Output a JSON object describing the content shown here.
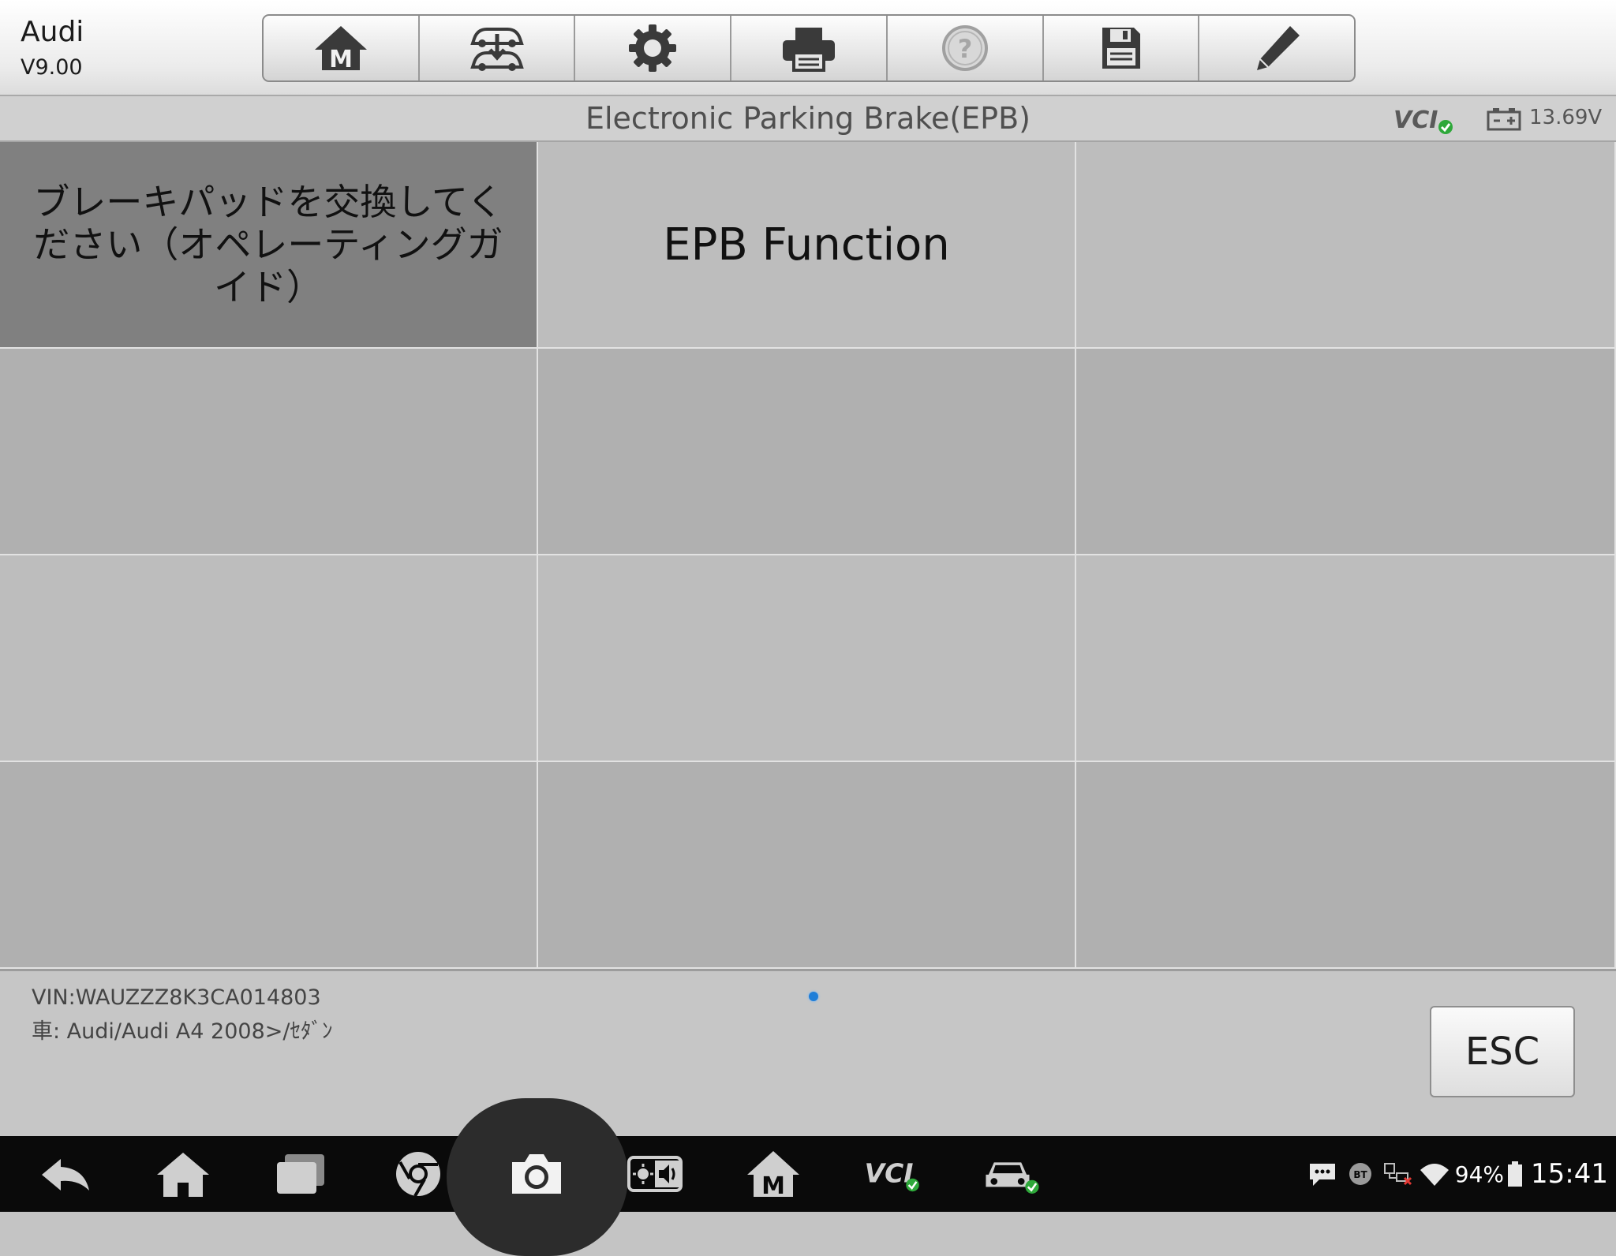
{
  "header": {
    "app_name": "Audi",
    "version": "V9.00",
    "toolbar": [
      {
        "name": "home",
        "icon": "home-m-icon"
      },
      {
        "name": "vehicle-swap",
        "icon": "vehicle-swap-icon"
      },
      {
        "name": "settings",
        "icon": "gear-icon"
      },
      {
        "name": "print",
        "icon": "printer-icon"
      },
      {
        "name": "help",
        "icon": "help-icon"
      },
      {
        "name": "save",
        "icon": "floppy-disk-icon"
      },
      {
        "name": "edit",
        "icon": "pencil-icon"
      }
    ]
  },
  "title_strip": {
    "title": "Electronic Parking Brake(EPB)",
    "vci_label": "VCI",
    "voltage": "13.69V"
  },
  "grid": {
    "cells": [
      {
        "label": "ブレーキパッドを交換してください（オペレーティングガイド）",
        "selected": true
      },
      {
        "label": "EPB Function"
      },
      {
        "label": ""
      },
      {
        "label": ""
      },
      {
        "label": ""
      },
      {
        "label": ""
      },
      {
        "label": ""
      },
      {
        "label": ""
      },
      {
        "label": ""
      },
      {
        "label": ""
      },
      {
        "label": ""
      },
      {
        "label": ""
      }
    ]
  },
  "footer": {
    "vin": "VIN:WAUZZZ8K3CA014803",
    "vehicle": "車: Audi/Audi A4 2008>/ｾﾀﾞﾝ",
    "esc_label": "ESC"
  },
  "system_bar": {
    "battery_percent": "94%",
    "time": "15:41",
    "bt_label": "BT"
  },
  "colors": {
    "selected_cell": "#808080",
    "cell_light": "#bdbdbd",
    "cell_dark": "#b0b0b0",
    "vci_check": "#2ea83a",
    "page_dot": "#1f7ed8"
  }
}
